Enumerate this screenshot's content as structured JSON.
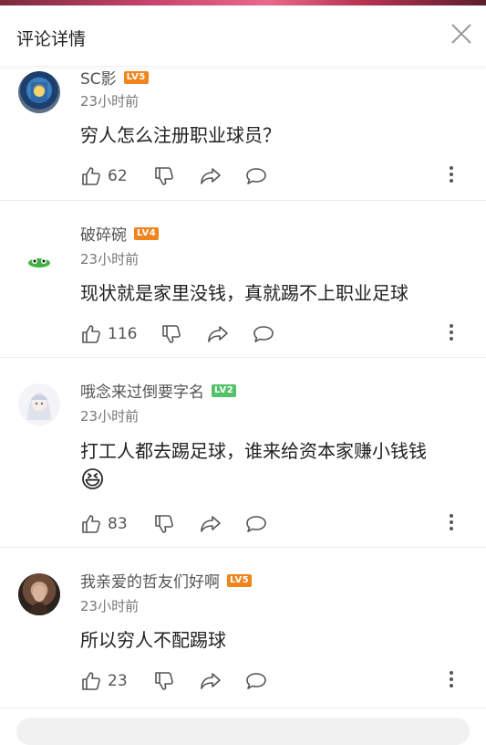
{
  "header": {
    "title": "评论详情"
  },
  "comments": [
    {
      "user": "SC影",
      "level": "LV5",
      "time": "23小时前",
      "text": "穷人怎么注册职业球员？",
      "likes": "62"
    },
    {
      "user": "破碎碗",
      "level": "LV4",
      "time": "23小时前",
      "text": "现状就是家里没钱，真就踢不上职业足球",
      "likes": "116"
    },
    {
      "user": "哦念来过倒要字名",
      "level": "LV2",
      "time": "23小时前",
      "text": "打工人都去踢足球，谁来给资本家赚小钱钱",
      "likes": "83",
      "emoji": "😆"
    },
    {
      "user": "我亲爱的哲友们好啊",
      "level": "LV5",
      "time": "23小时前",
      "text": "所以穷人不配踢球",
      "likes": "23"
    }
  ],
  "colors": {
    "level_orange": "#f0851d",
    "level_green": "#53c26a"
  },
  "icons": [
    "close-icon",
    "thumbs-up-icon",
    "thumbs-down-icon",
    "share-icon",
    "comment-icon",
    "more-icon"
  ]
}
